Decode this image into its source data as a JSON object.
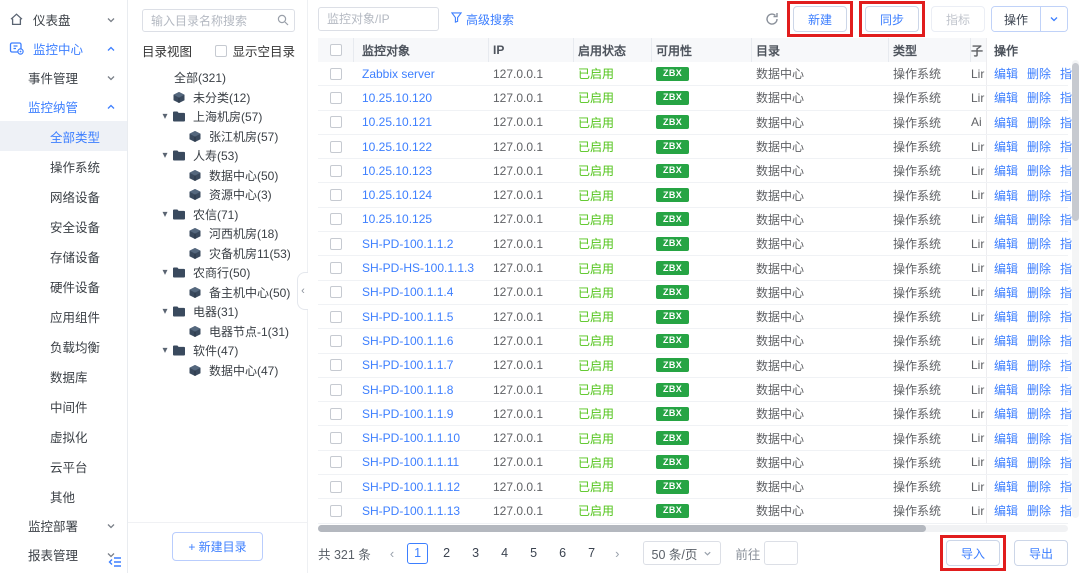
{
  "sidebar": {
    "items": [
      {
        "label": "仪表盘",
        "level": 1,
        "icon": "home",
        "chevron": "down"
      },
      {
        "label": "监控中心",
        "level": 1,
        "icon": "monitor",
        "chevron": "up",
        "active": true
      },
      {
        "label": "事件管理",
        "level": 2,
        "chevron": "down"
      },
      {
        "label": "监控纳管",
        "level": 2,
        "chevron": "up",
        "active": true
      },
      {
        "label": "全部类型",
        "level": 3,
        "selected": true
      },
      {
        "label": "操作系统",
        "level": 3
      },
      {
        "label": "网络设备",
        "level": 3
      },
      {
        "label": "安全设备",
        "level": 3
      },
      {
        "label": "存储设备",
        "level": 3
      },
      {
        "label": "硬件设备",
        "level": 3
      },
      {
        "label": "应用组件",
        "level": 3
      },
      {
        "label": "负载均衡",
        "level": 3
      },
      {
        "label": "数据库",
        "level": 3
      },
      {
        "label": "中间件",
        "level": 3
      },
      {
        "label": "虚拟化",
        "level": 3
      },
      {
        "label": "云平台",
        "level": 3
      },
      {
        "label": "其他",
        "level": 3
      },
      {
        "label": "监控部署",
        "level": 2,
        "chevron": "down"
      },
      {
        "label": "报表管理",
        "level": 2,
        "chevron": "down"
      }
    ]
  },
  "tree": {
    "search_placeholder": "输入目录名称搜索",
    "view_label": "目录视图",
    "empty_checkbox_label": "显示空目录",
    "new_dir_button": "+ 新建目录",
    "nodes": [
      {
        "label": "全部(321)",
        "level": 0
      },
      {
        "label": "未分类(12)",
        "level": 1,
        "icon": "cube"
      },
      {
        "label": "上海机房(57)",
        "level": 1,
        "icon": "folder",
        "caret": true
      },
      {
        "label": "张江机房(57)",
        "level": 2,
        "icon": "cube"
      },
      {
        "label": "人寿(53)",
        "level": 1,
        "icon": "folder",
        "caret": true
      },
      {
        "label": "数据中心(50)",
        "level": 2,
        "icon": "cube"
      },
      {
        "label": "资源中心(3)",
        "level": 2,
        "icon": "cube"
      },
      {
        "label": "农信(71)",
        "level": 1,
        "icon": "folder",
        "caret": true
      },
      {
        "label": "河西机房(18)",
        "level": 2,
        "icon": "cube"
      },
      {
        "label": "灾备机房11(53)",
        "level": 2,
        "icon": "cube"
      },
      {
        "label": "农商行(50)",
        "level": 1,
        "icon": "folder",
        "caret": true
      },
      {
        "label": "备主机中心(50)",
        "level": 2,
        "icon": "cube"
      },
      {
        "label": "电器(31)",
        "level": 1,
        "icon": "folder",
        "caret": true
      },
      {
        "label": "电器节点-1(31)",
        "level": 2,
        "icon": "cube"
      },
      {
        "label": "软件(47)",
        "level": 1,
        "icon": "folder",
        "caret": true
      },
      {
        "label": "数据中心(47)",
        "level": 2,
        "icon": "cube"
      }
    ]
  },
  "toolbar": {
    "search_placeholder": "监控对象/IP",
    "advanced_search": "高级搜索",
    "new_button": "新建",
    "sync_button": "同步",
    "metric_button": "指标",
    "action_button": "操作"
  },
  "table": {
    "columns": [
      "监控对象",
      "IP",
      "启用状态",
      "可用性",
      "目录",
      "类型",
      "子",
      "操作"
    ],
    "row_actions": [
      "编辑",
      "删除",
      "指标"
    ],
    "rows": [
      {
        "name": "Zabbix server",
        "ip": "127.0.0.1",
        "status": "已启用",
        "availability": "ZBX",
        "directory": "数据中心",
        "type": "操作系统",
        "subtype": "Lir"
      },
      {
        "name": "10.25.10.120",
        "ip": "127.0.0.1",
        "status": "已启用",
        "availability": "ZBX",
        "directory": "数据中心",
        "type": "操作系统",
        "subtype": "Lir"
      },
      {
        "name": "10.25.10.121",
        "ip": "127.0.0.1",
        "status": "已启用",
        "availability": "ZBX",
        "directory": "数据中心",
        "type": "操作系统",
        "subtype": "Ai"
      },
      {
        "name": "10.25.10.122",
        "ip": "127.0.0.1",
        "status": "已启用",
        "availability": "ZBX",
        "directory": "数据中心",
        "type": "操作系统",
        "subtype": "Lir"
      },
      {
        "name": "10.25.10.123",
        "ip": "127.0.0.1",
        "status": "已启用",
        "availability": "ZBX",
        "directory": "数据中心",
        "type": "操作系统",
        "subtype": "Lir"
      },
      {
        "name": "10.25.10.124",
        "ip": "127.0.0.1",
        "status": "已启用",
        "availability": "ZBX",
        "directory": "数据中心",
        "type": "操作系统",
        "subtype": "Lir"
      },
      {
        "name": "10.25.10.125",
        "ip": "127.0.0.1",
        "status": "已启用",
        "availability": "ZBX",
        "directory": "数据中心",
        "type": "操作系统",
        "subtype": "Lir"
      },
      {
        "name": "SH-PD-100.1.1.2",
        "ip": "127.0.0.1",
        "status": "已启用",
        "availability": "ZBX",
        "directory": "数据中心",
        "type": "操作系统",
        "subtype": "Lir"
      },
      {
        "name": "SH-PD-HS-100.1.1.3",
        "ip": "127.0.0.1",
        "status": "已启用",
        "availability": "ZBX",
        "directory": "数据中心",
        "type": "操作系统",
        "subtype": "Lir"
      },
      {
        "name": "SH-PD-100.1.1.4",
        "ip": "127.0.0.1",
        "status": "已启用",
        "availability": "ZBX",
        "directory": "数据中心",
        "type": "操作系统",
        "subtype": "Lir"
      },
      {
        "name": "SH-PD-100.1.1.5",
        "ip": "127.0.0.1",
        "status": "已启用",
        "availability": "ZBX",
        "directory": "数据中心",
        "type": "操作系统",
        "subtype": "Lir"
      },
      {
        "name": "SH-PD-100.1.1.6",
        "ip": "127.0.0.1",
        "status": "已启用",
        "availability": "ZBX",
        "directory": "数据中心",
        "type": "操作系统",
        "subtype": "Lir"
      },
      {
        "name": "SH-PD-100.1.1.7",
        "ip": "127.0.0.1",
        "status": "已启用",
        "availability": "ZBX",
        "directory": "数据中心",
        "type": "操作系统",
        "subtype": "Lir"
      },
      {
        "name": "SH-PD-100.1.1.8",
        "ip": "127.0.0.1",
        "status": "已启用",
        "availability": "ZBX",
        "directory": "数据中心",
        "type": "操作系统",
        "subtype": "Lir"
      },
      {
        "name": "SH-PD-100.1.1.9",
        "ip": "127.0.0.1",
        "status": "已启用",
        "availability": "ZBX",
        "directory": "数据中心",
        "type": "操作系统",
        "subtype": "Lir"
      },
      {
        "name": "SH-PD-100.1.1.10",
        "ip": "127.0.0.1",
        "status": "已启用",
        "availability": "ZBX",
        "directory": "数据中心",
        "type": "操作系统",
        "subtype": "Lir"
      },
      {
        "name": "SH-PD-100.1.1.11",
        "ip": "127.0.0.1",
        "status": "已启用",
        "availability": "ZBX",
        "directory": "数据中心",
        "type": "操作系统",
        "subtype": "Lir"
      },
      {
        "name": "SH-PD-100.1.1.12",
        "ip": "127.0.0.1",
        "status": "已启用",
        "availability": "ZBX",
        "directory": "数据中心",
        "type": "操作系统",
        "subtype": "Lir"
      },
      {
        "name": "SH-PD-100.1.1.13",
        "ip": "127.0.0.1",
        "status": "已启用",
        "availability": "ZBX",
        "directory": "数据中心",
        "type": "操作系统",
        "subtype": "Lir"
      }
    ]
  },
  "pagination": {
    "total": "共 321 条",
    "pages": [
      "1",
      "2",
      "3",
      "4",
      "5",
      "6",
      "7"
    ],
    "current_page": "1",
    "page_size": "50 条/页",
    "goto_label": "前往"
  },
  "footer": {
    "import_button": "导入",
    "export_button": "导出"
  },
  "icons": {
    "prev": "‹",
    "next": "›",
    "collapse_tree": "‹",
    "caret_down": "▾"
  },
  "colors": {
    "accent": "#3d7fff",
    "status_green": "#52c41a",
    "badge_green": "#26a444",
    "annotation_red": "#e11d1d"
  }
}
